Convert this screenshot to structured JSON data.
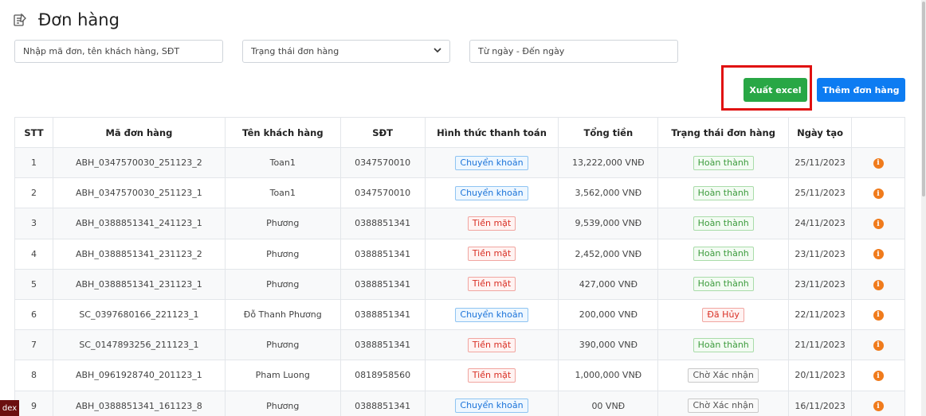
{
  "page": {
    "title": "Đơn hàng",
    "icon": "order-list-icon"
  },
  "filters": {
    "search_placeholder": "Nhập mã đơn, tên khách hàng, SĐT",
    "status_selected": "Trạng thái đơn hàng",
    "date_placeholder": "Từ ngày - Đến ngày"
  },
  "actions": {
    "export_label": "Xuất excel",
    "add_label": "Thêm đơn hàng"
  },
  "colors": {
    "export": "#28a745",
    "add": "#0d7cf2",
    "highlight": "#e01010",
    "info_icon": "#f07b1c"
  },
  "table": {
    "headers": [
      "STT",
      "Mã đơn hàng",
      "Tên khách hàng",
      "SĐT",
      "Hình thức thanh toán",
      "Tổng tiền",
      "Trạng thái đơn hàng",
      "Ngày tạo",
      ""
    ],
    "rows": [
      {
        "stt": "1",
        "code": "ABH_0347570030_251123_2",
        "customer": "Toan1",
        "phone": "0347570010",
        "payment": "Chuyển khoản",
        "payment_type": "blue",
        "total": "13,222,000 VNĐ",
        "status": "Hoàn thành",
        "status_type": "green",
        "date": "25/11/2023"
      },
      {
        "stt": "2",
        "code": "ABH_0347570030_251123_1",
        "customer": "Toan1",
        "phone": "0347570010",
        "payment": "Chuyển khoản",
        "payment_type": "blue",
        "total": "3,562,000 VNĐ",
        "status": "Hoàn thành",
        "status_type": "green",
        "date": "25/11/2023"
      },
      {
        "stt": "3",
        "code": "ABH_0388851341_241123_1",
        "customer": "Phương",
        "phone": "0388851341",
        "payment": "Tiền mặt",
        "payment_type": "red",
        "total": "9,539,000 VNĐ",
        "status": "Hoàn thành",
        "status_type": "green",
        "date": "24/11/2023"
      },
      {
        "stt": "4",
        "code": "ABH_0388851341_231123_2",
        "customer": "Phương",
        "phone": "0388851341",
        "payment": "Tiền mặt",
        "payment_type": "red",
        "total": "2,452,000 VNĐ",
        "status": "Hoàn thành",
        "status_type": "green",
        "date": "23/11/2023"
      },
      {
        "stt": "5",
        "code": "ABH_0388851341_231123_1",
        "customer": "Phương",
        "phone": "0388851341",
        "payment": "Tiền mặt",
        "payment_type": "red",
        "total": "427,000 VNĐ",
        "status": "Hoàn thành",
        "status_type": "green",
        "date": "23/11/2023"
      },
      {
        "stt": "6",
        "code": "SC_0397680166_221123_1",
        "customer": "Đỗ Thanh Phương",
        "phone": "0388851341",
        "payment": "Chuyển khoản",
        "payment_type": "blue",
        "total": "200,000 VNĐ",
        "status": "Đã Hủy",
        "status_type": "red",
        "date": "22/11/2023"
      },
      {
        "stt": "7",
        "code": "SC_0147893256_211123_1",
        "customer": "Phương",
        "phone": "0388851341",
        "payment": "Tiền mặt",
        "payment_type": "red",
        "total": "390,000 VNĐ",
        "status": "Hoàn thành",
        "status_type": "green",
        "date": "21/11/2023"
      },
      {
        "stt": "8",
        "code": "ABH_0961928740_201123_1",
        "customer": "Pham Luong",
        "phone": "0818958560",
        "payment": "Tiền mặt",
        "payment_type": "red",
        "total": "1,000,000 VNĐ",
        "status": "Chờ Xác nhận",
        "status_type": "grey",
        "date": "20/11/2023"
      },
      {
        "stt": "9",
        "code": "ABH_0388851341_161123_8",
        "customer": "Phương",
        "phone": "0388851341",
        "payment": "Chuyển khoản",
        "payment_type": "blue",
        "total": "00 VNĐ",
        "status": "Chờ Xác nhận",
        "status_type": "grey",
        "date": "16/11/2023"
      }
    ]
  },
  "corner_tab": "dex"
}
